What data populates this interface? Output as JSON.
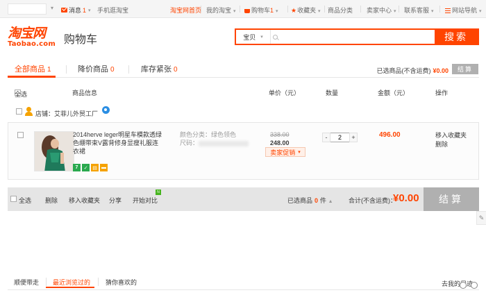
{
  "topnav": {
    "message_label": "消息",
    "message_count": "1",
    "mobile_label": "手机逛淘宝",
    "home_label": "淘宝网首页",
    "my_taobao": "我的淘宝",
    "cart_label": "购物车",
    "cart_count": "1",
    "favorites": "收藏夹",
    "categories": "商品分类",
    "seller_center": "卖家中心",
    "contact": "联系客服",
    "sitenav": "网站导航"
  },
  "header": {
    "logo_cn": "淘宝网",
    "logo_en": "Taobao.com",
    "page_title": "购物车",
    "search_category": "宝贝",
    "search_value": "",
    "search_button": "搜索"
  },
  "tabs": [
    {
      "label": "全部商品",
      "count": "1"
    },
    {
      "label": "降价商品",
      "count": "0"
    },
    {
      "label": "库存紧张",
      "count": "0"
    }
  ],
  "selection_summary": {
    "label": "已选商品(不含运费)",
    "amount": "¥0.00",
    "checkout_small": "结算"
  },
  "columns": {
    "select_all": "全选",
    "item_info": "商品信息",
    "unit_price": "单价（元）",
    "quantity": "数量",
    "amount": "金额（元）",
    "operations": "操作"
  },
  "shop": {
    "label": "店铺：",
    "name": "艾菲儿外贸工厂"
  },
  "item": {
    "title": "2014herve leger明星车模款透绿色绷带束V露背修身显瘦礼服连衣裙",
    "color_label": "颜色分类：绿色领色",
    "size_label": "尺码：",
    "old_price": "338.00",
    "price": "248.00",
    "promo_label": "卖家促销",
    "quantity": "2",
    "minus": "-",
    "plus": "+",
    "subtotal": "496.00",
    "move_to_fav": "移入收藏夹",
    "delete": "删除"
  },
  "badges": [
    {
      "text": "7",
      "color": "#2aa94e"
    },
    {
      "text": "✓",
      "color": "#2aa94e"
    },
    {
      "text": "▤",
      "color": "#f5a200"
    },
    {
      "text": "▬",
      "color": "#f5a200"
    }
  ],
  "summary_bar": {
    "select_all": "全选",
    "delete": "删除",
    "move_to_fav": "移入收藏夹",
    "share": "分享",
    "compare": "开始对比",
    "new_tag": "N",
    "selected_label": "已选商品",
    "selected_count": "0",
    "selected_unit": "件",
    "total_label": "合计(不含运费)：",
    "total_amount": "¥0.00",
    "checkout": "结算"
  },
  "bottom_tabs": {
    "tabs": [
      "顺便带走",
      "最近浏览过的",
      "猜你喜欢的"
    ],
    "footprint": "去我的足迹"
  },
  "colors": {
    "accent": "#ff4400",
    "disabled": "#b0b0b0"
  }
}
